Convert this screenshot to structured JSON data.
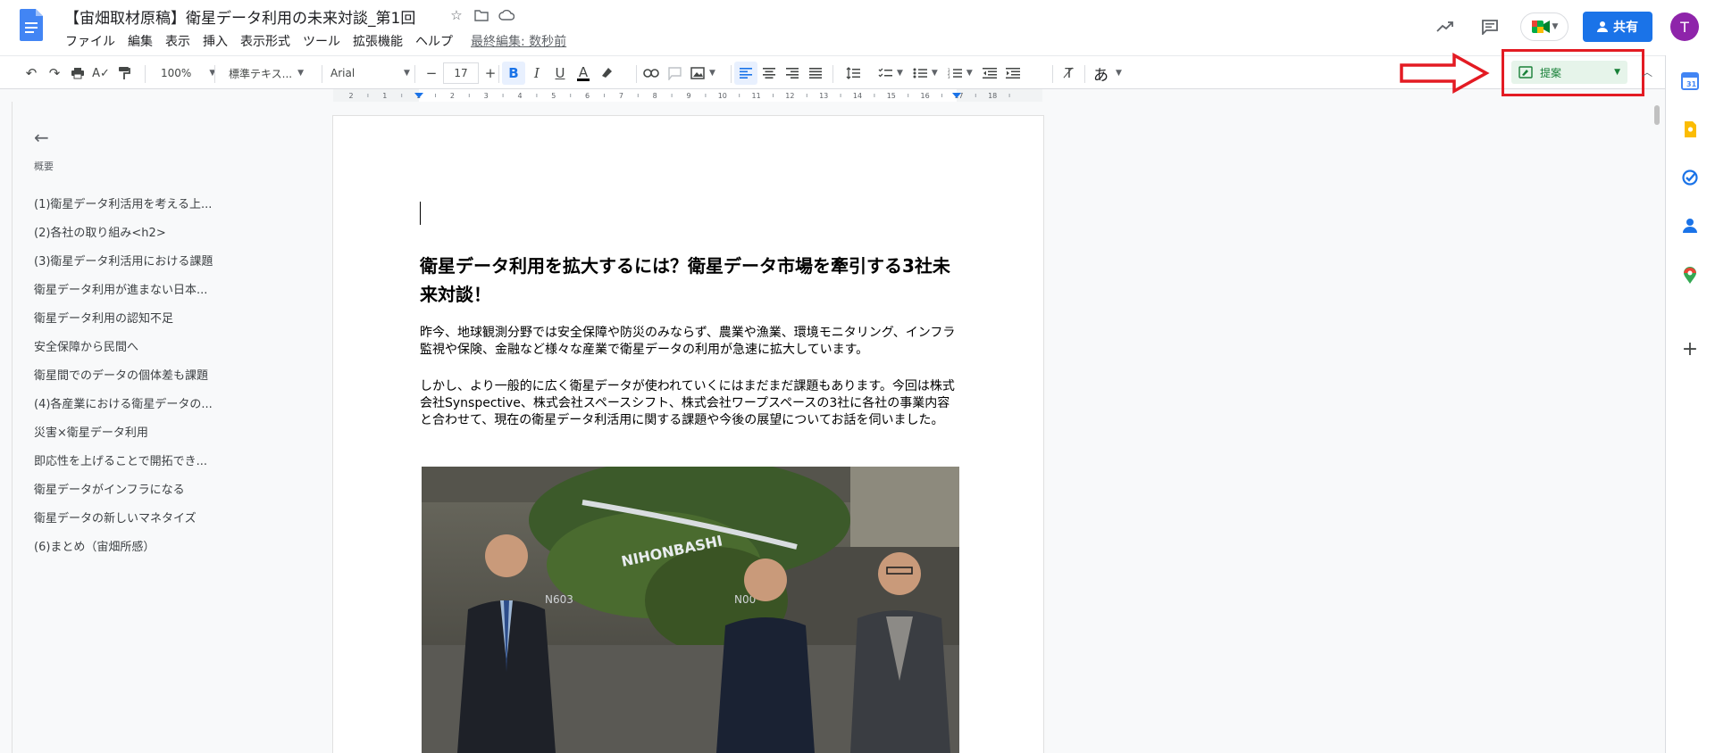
{
  "header": {
    "title": "【宙畑取材原稿】衛星データ利用の未来対談_第1回",
    "last_edit": "最終編集: 数秒前",
    "share_label": "共有",
    "avatar_initial": "T"
  },
  "menu": [
    "ファイル",
    "編集",
    "表示",
    "挿入",
    "表示形式",
    "ツール",
    "拡張機能",
    "ヘルプ"
  ],
  "toolbar": {
    "zoom": "100%",
    "style": "標準テキス...",
    "font": "Arial",
    "font_size": "17",
    "input_tool": "あ",
    "mode_label": "提案"
  },
  "ruler": {
    "ticks": [
      "2",
      "1",
      "1",
      "2",
      "3",
      "4",
      "5",
      "6",
      "7",
      "8",
      "9",
      "10",
      "11",
      "12",
      "13",
      "14",
      "15",
      "16",
      "17",
      "18"
    ]
  },
  "outline": {
    "title": "概要",
    "items": [
      "(1)衛星データ利活用を考える上...",
      "(2)各社の取り組み<h2>",
      "(3)衛星データ利活用における課題",
      "衛星データ利用が進まない日本...",
      "衛星データ利用の認知不足",
      "安全保障から民間へ",
      "衛星間でのデータの個体差も課題",
      "(4)各産業における衛星データの...",
      "災害×衛星データ利用",
      "即応性を上げることで開拓でき...",
      "衛星データがインフラになる",
      "衛星データの新しいマネタイズ",
      "(6)まとめ（宙畑所感）"
    ]
  },
  "document": {
    "heading": "衛星データ利用を拡大するには？衛星データ市場を牽引する3社未来対談！",
    "paragraph1": "昨今、地球観測分野では安全保障や防災のみならず、農業や漁業、環境モニタリング、インフラ監視や保険、金融など様々な産業で衛星データの利用が急速に拡大しています。",
    "paragraph2": "しかし、より一般的に広く衛星データが使われていくにはまだまだ課題もあります。今回は株式会社Synspective、株式会社スペースシフト、株式会社ワープスペースの3社に各社の事業内容と合わせて、現在の衛星データ利活用に関する課題や今後の展望についてお話を伺いました。",
    "photo_sign_text": "NIHONBASHI",
    "photo_wall_labels": [
      "N603",
      "N00"
    ]
  },
  "colors": {
    "accent": "#1a73e8",
    "suggest_green": "#188038",
    "annotation_red": "#e31b23",
    "avatar": "#8e24aa"
  }
}
